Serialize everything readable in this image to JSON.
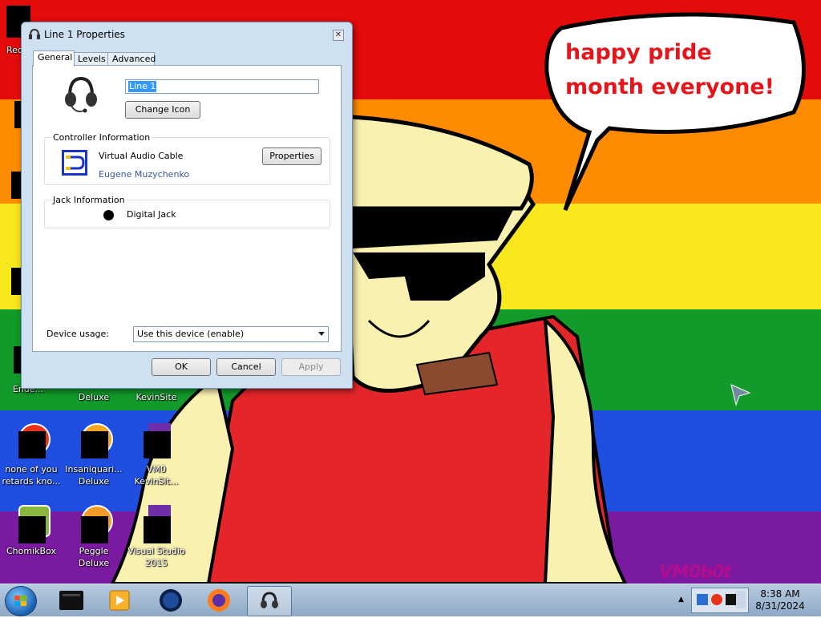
{
  "wallpaper": {
    "speech_text": "happy pride month everyone!",
    "watermark": "VM0b0t",
    "stripe_colors": [
      "#e40b0b",
      "#ff8c00",
      "#f8e71c",
      "#129a2a",
      "#1f4fe0",
      "#7a1aa0"
    ]
  },
  "desktop_icons": [
    {
      "label": "Rec"
    },
    {
      "label": "Ende..."
    },
    {
      "label": "Deluxe"
    },
    {
      "label": "KevinSite"
    },
    {
      "label": "none of you retards kno..."
    },
    {
      "label": "Insaniquari... Deluxe"
    },
    {
      "label": "VM0 KevinSit..."
    },
    {
      "label": "ChomikBox"
    },
    {
      "label": "Peggle Deluxe"
    },
    {
      "label": "Visual Studio 2015"
    }
  ],
  "dialog": {
    "title": "Line 1 Properties",
    "close_glyph": "✕",
    "tabs": [
      "General",
      "Levels",
      "Advanced"
    ],
    "name_value": "Line 1",
    "change_icon_label": "Change Icon",
    "controller": {
      "heading": "Controller Information",
      "name": "Virtual Audio Cable",
      "vendor": "Eugene Muzychenko",
      "properties_label": "Properties"
    },
    "jack": {
      "heading": "Jack Information",
      "name": "Digital Jack"
    },
    "device_usage": {
      "label": "Device usage:",
      "selected": "Use this device (enable)"
    },
    "buttons": {
      "ok": "OK",
      "cancel": "Cancel",
      "apply": "Apply"
    }
  },
  "taskbar": {
    "time": "8:38 AM",
    "date": "8/31/2024",
    "tray_arrow": "▲"
  }
}
